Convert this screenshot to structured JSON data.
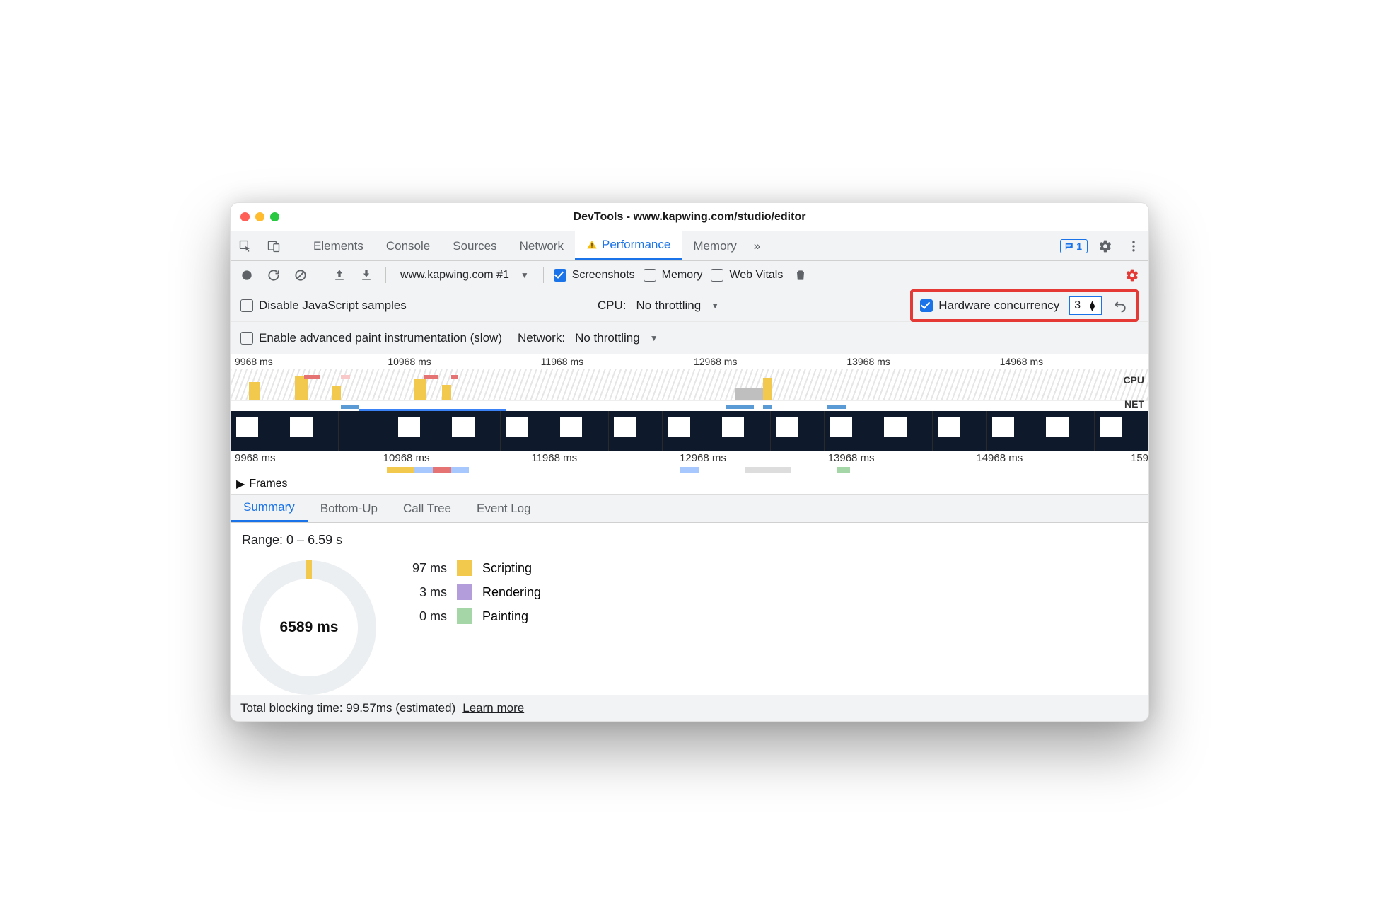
{
  "window": {
    "title": "DevTools - www.kapwing.com/studio/editor"
  },
  "mainTabs": {
    "items": [
      "Elements",
      "Console",
      "Sources",
      "Network",
      "Performance",
      "Memory"
    ],
    "active": "Performance",
    "overflow": "»",
    "messagesBadge": "1"
  },
  "perfToolbar": {
    "target": "www.kapwing.com #1",
    "screenshots": {
      "label": "Screenshots",
      "checked": true
    },
    "memory": {
      "label": "Memory",
      "checked": false
    },
    "webvitals": {
      "label": "Web Vitals",
      "checked": false
    }
  },
  "settingsRow1": {
    "disableJS": {
      "label": "Disable JavaScript samples",
      "checked": false
    },
    "cpu": {
      "label": "CPU:",
      "value": "No throttling"
    },
    "hw": {
      "label": "Hardware concurrency",
      "checked": true,
      "value": "3"
    }
  },
  "settingsRow2": {
    "paintInstr": {
      "label": "Enable advanced paint instrumentation (slow)",
      "checked": false
    },
    "network": {
      "label": "Network:",
      "value": "No throttling"
    }
  },
  "overview": {
    "ticks": [
      "9968 ms",
      "10968 ms",
      "11968 ms",
      "12968 ms",
      "13968 ms",
      "14968 ms"
    ],
    "cpuLabel": "CPU",
    "netLabel": "NET",
    "ruler2": [
      "9968 ms",
      "10968 ms",
      "11968 ms",
      "12968 ms",
      "13968 ms",
      "14968 ms",
      "159"
    ]
  },
  "frames": {
    "label": "Frames"
  },
  "subTabs": {
    "items": [
      "Summary",
      "Bottom-Up",
      "Call Tree",
      "Event Log"
    ],
    "active": "Summary"
  },
  "summary": {
    "range": "Range: 0 – 6.59 s",
    "donut": "6589 ms",
    "legend": [
      {
        "ms": "97 ms",
        "name": "Scripting",
        "sw": "sw1"
      },
      {
        "ms": "3 ms",
        "name": "Rendering",
        "sw": "sw2"
      },
      {
        "ms": "0 ms",
        "name": "Painting",
        "sw": "sw3"
      }
    ]
  },
  "footer": {
    "text": "Total blocking time: 99.57ms (estimated)",
    "link": "Learn more"
  }
}
